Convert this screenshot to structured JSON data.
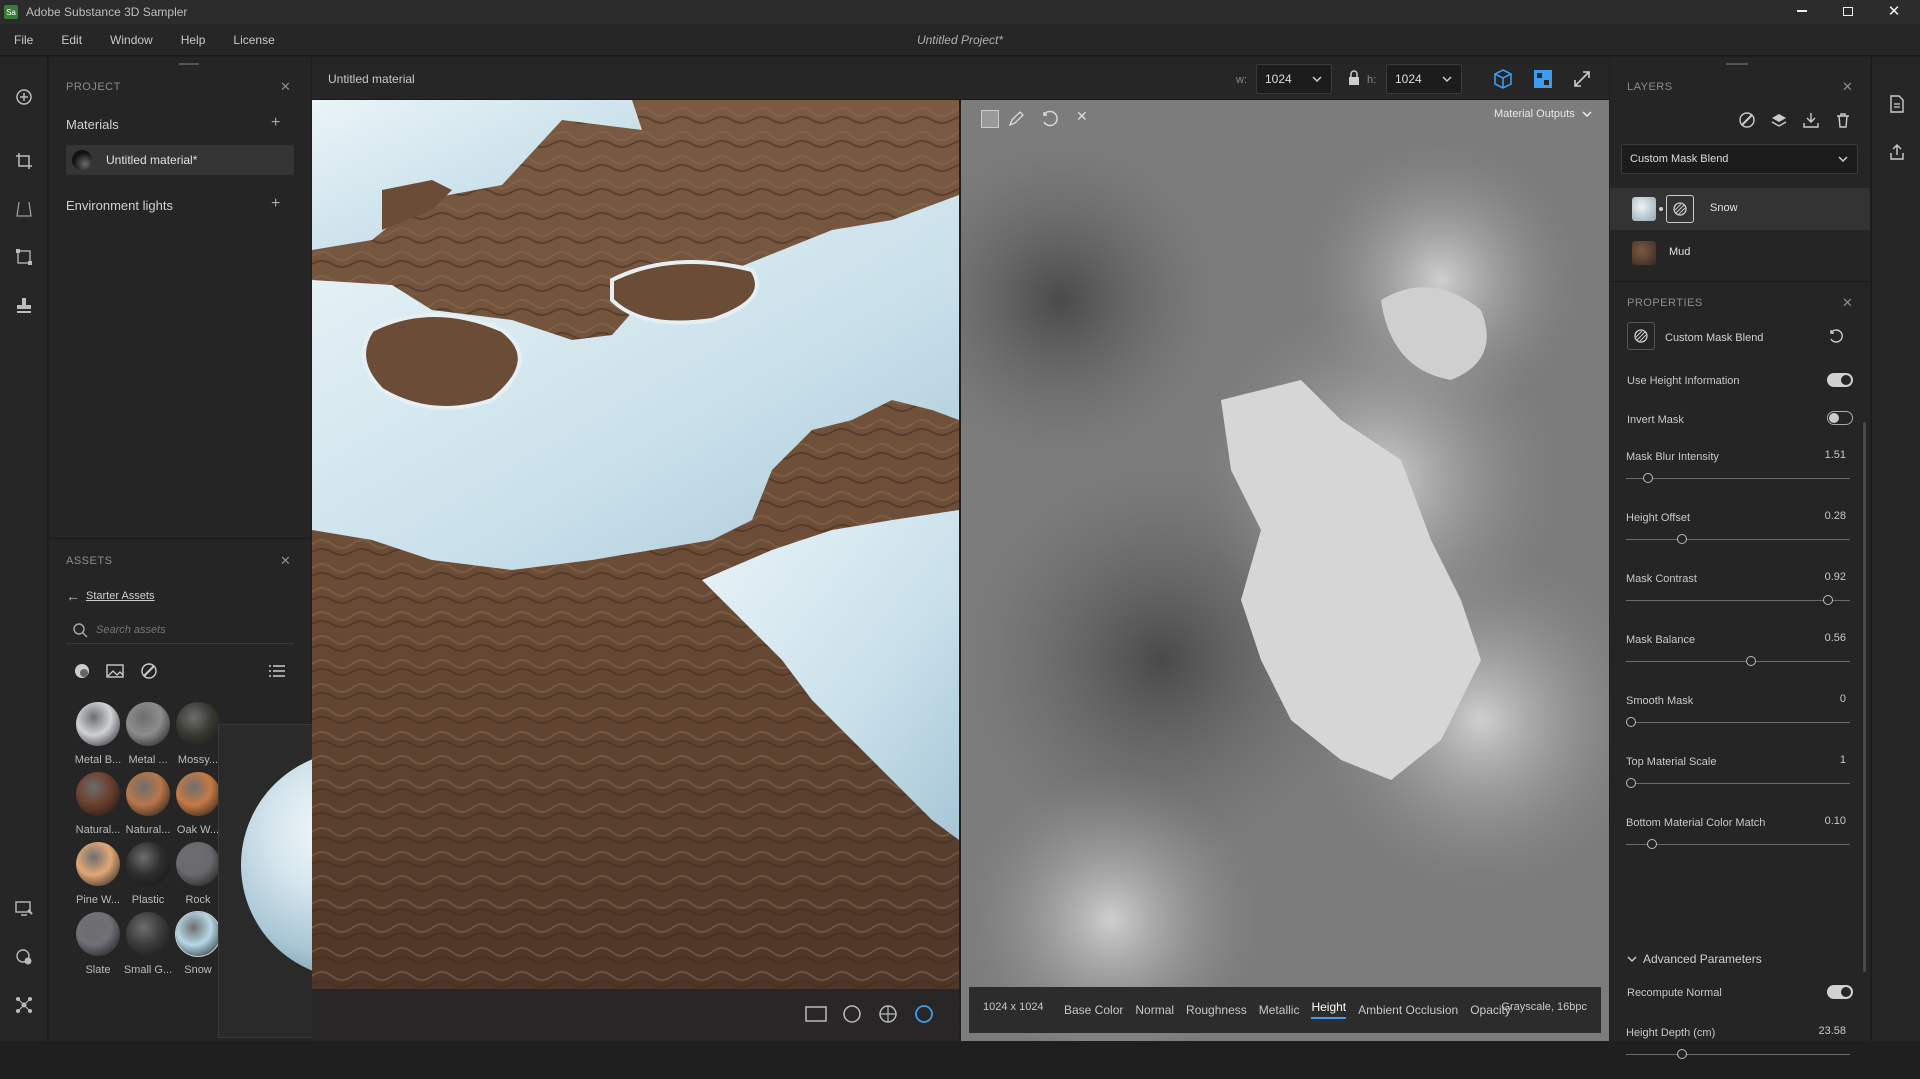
{
  "app": {
    "name": "Adobe Substance 3D Sampler",
    "logo": "Sa",
    "doc_title": "Untitled Project*"
  },
  "menu": [
    "File",
    "Edit",
    "Window",
    "Help",
    "License"
  ],
  "window_controls": [
    "minimize-icon",
    "restore-icon",
    "close-icon"
  ],
  "project": {
    "header": "PROJECT",
    "materials_label": "Materials",
    "material_item": "Untitled material*",
    "env_label": "Environment lights"
  },
  "assets": {
    "header": "ASSETS",
    "back_label": "Starter Assets",
    "search_placeholder": "Search assets",
    "items": [
      {
        "label": "Metal B...",
        "color": "#cfd2d6"
      },
      {
        "label": "Metal ...",
        "color": "#8d8d8d"
      },
      {
        "label": "Mossy...",
        "color": "#3a3a34"
      },
      {
        "label": "Natural...",
        "color": "#6b3f2c"
      },
      {
        "label": "Natural...",
        "color": "#b8774a"
      },
      {
        "label": "Oak W...",
        "color": "#c57a45"
      },
      {
        "label": "Pine W...",
        "color": "#e0a877"
      },
      {
        "label": "Plastic",
        "color": "#2f2f2f"
      },
      {
        "label": "Rock",
        "color": "#6a6a6e"
      },
      {
        "label": "Slate",
        "color": "#707076"
      },
      {
        "label": "Small G...",
        "color": "#3c3c3c"
      },
      {
        "label": "Snow",
        "color": "#b6d8e6"
      }
    ],
    "preview_label": "Snow"
  },
  "toolbar": {
    "material_name": "Untitled material",
    "w_label": "w:",
    "w_value": "1024",
    "h_label": "h:",
    "h_value": "1024"
  },
  "view2d": {
    "outputs_label": "Material Outputs",
    "resolution": "1024 x 1024",
    "channels": [
      "Base Color",
      "Normal",
      "Roughness",
      "Metallic",
      "Height",
      "Ambient Occlusion",
      "Opacity"
    ],
    "active_channel": "Height",
    "format": "Grayscale, 16bpc"
  },
  "layers": {
    "header": "LAYERS",
    "blend_mode": "Custom Mask Blend",
    "items": [
      {
        "name": "Snow",
        "color": "#dfe7ee"
      },
      {
        "name": "Mud",
        "color": "#5a3f30"
      }
    ]
  },
  "properties": {
    "header": "PROPERTIES",
    "filter_name": "Custom Mask Blend",
    "use_height_label": "Use Height Information",
    "use_height": true,
    "invert_mask_label": "Invert Mask",
    "invert_mask": false,
    "sliders": [
      {
        "label": "Mask Blur Intensity",
        "value": "1.51",
        "fraction": 0.08
      },
      {
        "label": "Height Offset",
        "value": "0.28",
        "fraction": 0.24
      },
      {
        "label": "Mask Contrast",
        "value": "0.92",
        "fraction": 0.92
      },
      {
        "label": "Mask Balance",
        "value": "0.56",
        "fraction": 0.56
      },
      {
        "label": "Smooth Mask",
        "value": "0",
        "fraction": 0.0
      },
      {
        "label": "Top Material Scale",
        "value": "1",
        "fraction": 0.0
      },
      {
        "label": "Bottom Material Color Match",
        "value": "0.10",
        "fraction": 0.1
      }
    ],
    "advanced_label": "Advanced Parameters",
    "recompute_label": "Recompute Normal",
    "recompute": true,
    "height_depth": {
      "label": "Height Depth (cm)",
      "value": "23.58",
      "fraction": 0.24
    }
  }
}
